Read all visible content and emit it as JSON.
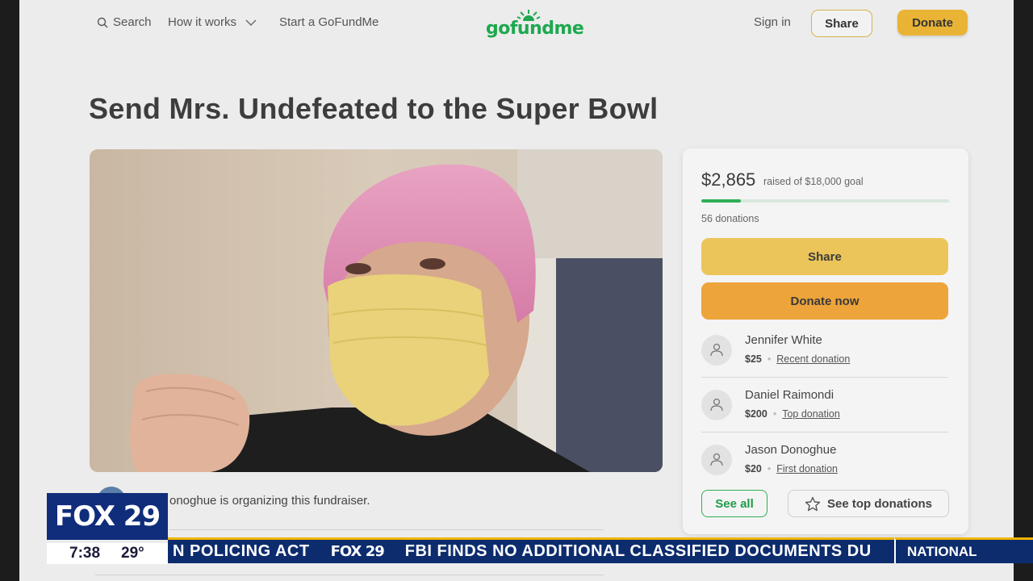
{
  "header": {
    "search_label": "Search",
    "how_it_works_label": "How it works",
    "start_label": "Start a GoFundMe",
    "logo_text": "gofundme",
    "sign_in_label": "Sign in",
    "share_label": "Share",
    "donate_label": "Donate"
  },
  "campaign": {
    "title": "Send Mrs. Undefeated to the Super Bowl",
    "organizer_text": "onoghue is organizing this fundraiser."
  },
  "donation_card": {
    "raised": "$2,865",
    "goal_text": "raised of $18,000 goal",
    "progress_fraction": 0.159,
    "donations_count": "56 donations",
    "share_label": "Share",
    "donate_now_label": "Donate now",
    "donors": [
      {
        "name": "Jennifer White",
        "amount": "$25",
        "tag": "Recent donation"
      },
      {
        "name": "Daniel Raimondi",
        "amount": "$200",
        "tag": "Top donation"
      },
      {
        "name": "Jason Donoghue",
        "amount": "$20",
        "tag": "First donation"
      }
    ],
    "see_all_label": "See all",
    "see_top_label": "See top donations"
  },
  "broadcast": {
    "station": "FOX 29",
    "time": "7:38",
    "temp": "29°",
    "ticker_left": "N POLICING ACT",
    "ticker_logo": "FOX 29",
    "ticker_main": "FBI FINDS NO ADDITIONAL CLASSIFIED DOCUMENTS DU",
    "ticker_right": "NATIONAL"
  },
  "colors": {
    "brand_green": "#1fa84f",
    "donate_yellow": "#e9b436",
    "donate_orange": "#eda43a",
    "fox_blue": "#0f2d7a"
  }
}
